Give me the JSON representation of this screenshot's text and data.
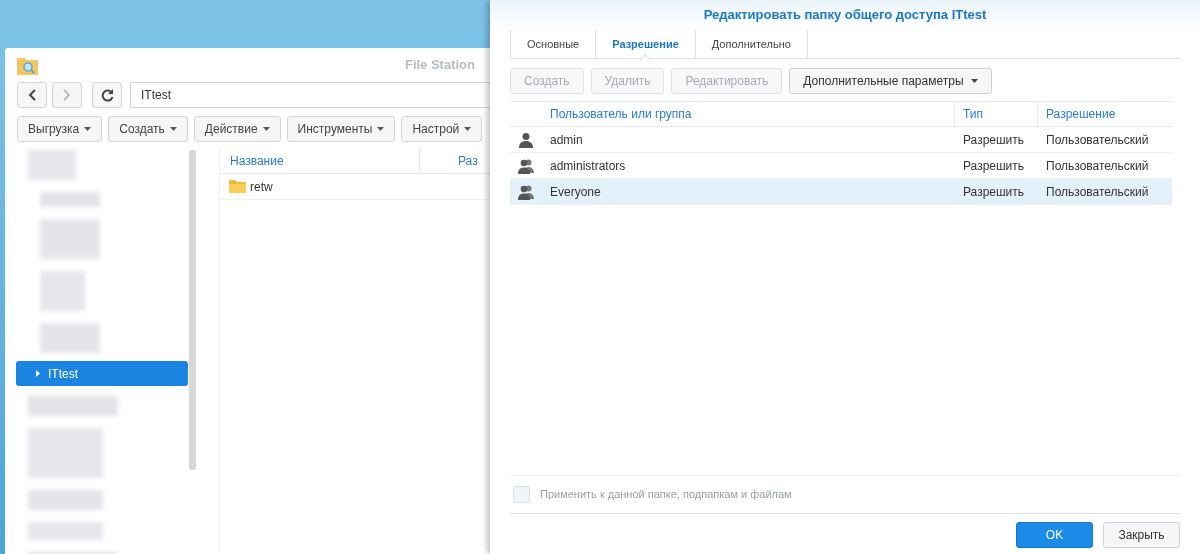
{
  "file_station": {
    "title": "File Station",
    "address": "ITtest",
    "toolbar": [
      {
        "label": "Выгрузка"
      },
      {
        "label": "Создать"
      },
      {
        "label": "Действие"
      },
      {
        "label": "Инструменты"
      },
      {
        "label": "Настрой"
      }
    ],
    "sidebar": {
      "items": [
        {
          "label": "ITtest",
          "selected": true
        }
      ]
    },
    "columns": [
      "Название",
      "Раз"
    ],
    "files": [
      {
        "name": "retw",
        "kind": "folder"
      }
    ]
  },
  "dialog": {
    "title": "Редактировать папку общего доступа ITtest",
    "tabs": [
      {
        "label": "Основные",
        "selected": false
      },
      {
        "label": "Разрешение",
        "selected": true
      },
      {
        "label": "Дополнительно",
        "selected": false
      }
    ],
    "toolbar": [
      {
        "label": "Создать",
        "disabled": true,
        "dropdown": false
      },
      {
        "label": "Удалить",
        "disabled": true,
        "dropdown": false
      },
      {
        "label": "Редактировать",
        "disabled": true,
        "dropdown": false
      },
      {
        "label": "Дополнительные параметры",
        "disabled": false,
        "dropdown": true
      }
    ],
    "columns": [
      "Пользователь или группа",
      "Тип",
      "Разрешение"
    ],
    "rows": [
      {
        "kind": "user",
        "name": "admin",
        "type": "Разрешить",
        "permission": "Пользовательский",
        "selected": false
      },
      {
        "kind": "group",
        "name": "administrators",
        "type": "Разрешить",
        "permission": "Пользовательский",
        "selected": false
      },
      {
        "kind": "group",
        "name": "Everyone",
        "type": "Разрешить",
        "permission": "Пользовательский",
        "selected": true
      }
    ],
    "apply": {
      "label": "Применить к данной папке, подпапкам и файлам",
      "checked": false,
      "disabled": true
    },
    "buttons": [
      {
        "label": "OK",
        "kind": "primary"
      },
      {
        "label": "Закрыть",
        "kind": "secondary"
      }
    ]
  }
}
